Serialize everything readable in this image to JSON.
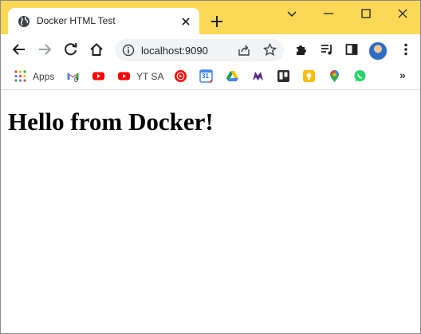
{
  "tab": {
    "title": "Docker HTML Test"
  },
  "toolbar": {
    "url": "localhost:9090"
  },
  "bookmarks": {
    "apps_label": "Apps",
    "gmail_badge": "0",
    "yt_sa_label": "YT SA",
    "calendar_day": "31",
    "more_label": "»"
  },
  "page": {
    "heading": "Hello from Docker!"
  },
  "colors": {
    "tabstrip": "#fcd856",
    "omnibox": "#f1f3f4",
    "youtube_red": "#ff0000"
  }
}
